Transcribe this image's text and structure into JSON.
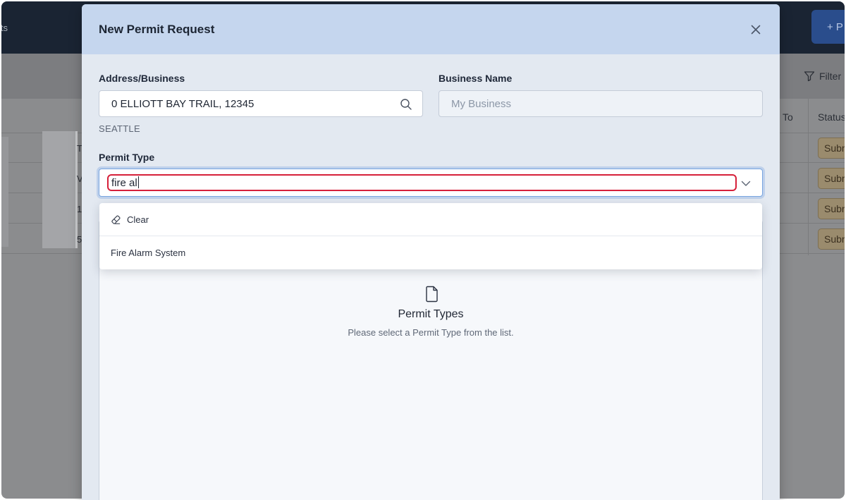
{
  "background": {
    "nav_partial": "its",
    "new_button_partial": "+ P",
    "filter_label": "Filter",
    "columns": {
      "to": "To",
      "status": "Status"
    },
    "row_chars": [
      "T",
      "V",
      "1",
      "5"
    ],
    "status_badges": [
      "Subr",
      "Subr",
      "Subr",
      "Subr"
    ]
  },
  "modal": {
    "title": "New Permit Request",
    "address": {
      "label": "Address/Business",
      "value": "0 ELLIOTT BAY TRAIL, 12345",
      "city": "SEATTLE"
    },
    "business_name": {
      "label": "Business Name",
      "placeholder": "My Business"
    },
    "permit_type": {
      "label": "Permit Type",
      "typed_value": "fire al"
    },
    "dropdown": {
      "clear_label": "Clear",
      "options": [
        "Fire Alarm System"
      ]
    },
    "empty_state": {
      "title": "Permit Types",
      "message": "Please select a Permit Type from the list."
    }
  },
  "colors": {
    "header_bg": "#c5d6ee",
    "modal_bg": "#e3e9f1",
    "highlight": "#d6203a",
    "focus_border": "#7aa6e0"
  }
}
